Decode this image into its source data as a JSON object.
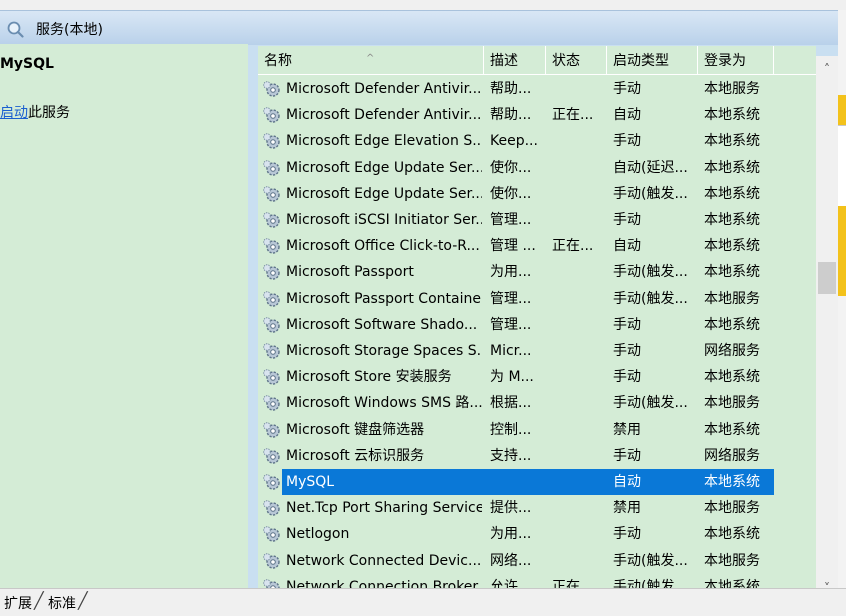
{
  "window": {
    "title": "服务(本地)",
    "title_icon": "services-search-icon"
  },
  "details": {
    "service_name": "MySQL",
    "start_link": "启动",
    "start_suffix": "此服务"
  },
  "table": {
    "columns": [
      "名称",
      "描述",
      "状态",
      "启动类型",
      "登录为"
    ],
    "sorted_column": "名称",
    "rows": [
      {
        "name": "Microsoft Defender Antivir...",
        "desc": "帮助...",
        "status": "",
        "start": "手动",
        "logon": "本地服务"
      },
      {
        "name": "Microsoft Defender Antivir...",
        "desc": "帮助...",
        "status": "正在...",
        "start": "自动",
        "logon": "本地系统"
      },
      {
        "name": "Microsoft Edge Elevation S...",
        "desc": "Keep...",
        "status": "",
        "start": "手动",
        "logon": "本地系统"
      },
      {
        "name": "Microsoft Edge Update Ser...",
        "desc": "使你...",
        "status": "",
        "start": "自动(延迟...",
        "logon": "本地系统"
      },
      {
        "name": "Microsoft Edge Update Ser...",
        "desc": "使你...",
        "status": "",
        "start": "手动(触发...",
        "logon": "本地系统"
      },
      {
        "name": "Microsoft iSCSI Initiator Ser...",
        "desc": "管理...",
        "status": "",
        "start": "手动",
        "logon": "本地系统"
      },
      {
        "name": "Microsoft Office Click-to-R...",
        "desc": "管理 ...",
        "status": "正在...",
        "start": "自动",
        "logon": "本地系统"
      },
      {
        "name": "Microsoft Passport",
        "desc": "为用...",
        "status": "",
        "start": "手动(触发...",
        "logon": "本地系统"
      },
      {
        "name": "Microsoft Passport Container",
        "desc": "管理...",
        "status": "",
        "start": "手动(触发...",
        "logon": "本地服务"
      },
      {
        "name": "Microsoft Software Shado...",
        "desc": "管理...",
        "status": "",
        "start": "手动",
        "logon": "本地系统"
      },
      {
        "name": "Microsoft Storage Spaces S...",
        "desc": "Micr...",
        "status": "",
        "start": "手动",
        "logon": "网络服务"
      },
      {
        "name": "Microsoft Store 安装服务",
        "desc": "为 M...",
        "status": "",
        "start": "手动",
        "logon": "本地系统"
      },
      {
        "name": "Microsoft Windows SMS 路...",
        "desc": "根据...",
        "status": "",
        "start": "手动(触发...",
        "logon": "本地服务"
      },
      {
        "name": "Microsoft 键盘筛选器",
        "desc": "控制...",
        "status": "",
        "start": "禁用",
        "logon": "本地系统"
      },
      {
        "name": "Microsoft 云标识服务",
        "desc": "支持...",
        "status": "",
        "start": "手动",
        "logon": "网络服务"
      },
      {
        "name": "MySQL",
        "desc": "",
        "status": "",
        "start": "自动",
        "logon": "本地系统",
        "selected": true
      },
      {
        "name": "Net.Tcp Port Sharing Service",
        "desc": "提供...",
        "status": "",
        "start": "禁用",
        "logon": "本地服务"
      },
      {
        "name": "Netlogon",
        "desc": "为用...",
        "status": "",
        "start": "手动",
        "logon": "本地系统"
      },
      {
        "name": "Network Connected Devic...",
        "desc": "网络...",
        "status": "",
        "start": "手动(触发...",
        "logon": "本地服务"
      },
      {
        "name": "Network Connection Broker",
        "desc": "允许...",
        "status": "正在...",
        "start": "手动(触发...",
        "logon": "本地系统"
      }
    ],
    "row_icon": "service-gear-icon",
    "selection_color": "#0a78d7"
  },
  "scrollbar": {
    "up": "˄",
    "down": "˅",
    "position_fraction": 0.38
  },
  "bottom_tabs": [
    "扩展",
    "标准"
  ],
  "colors": {
    "panel_bg": "#d4ecd6",
    "title_bg": "#c9dff1",
    "link": "#1a5fd0"
  }
}
